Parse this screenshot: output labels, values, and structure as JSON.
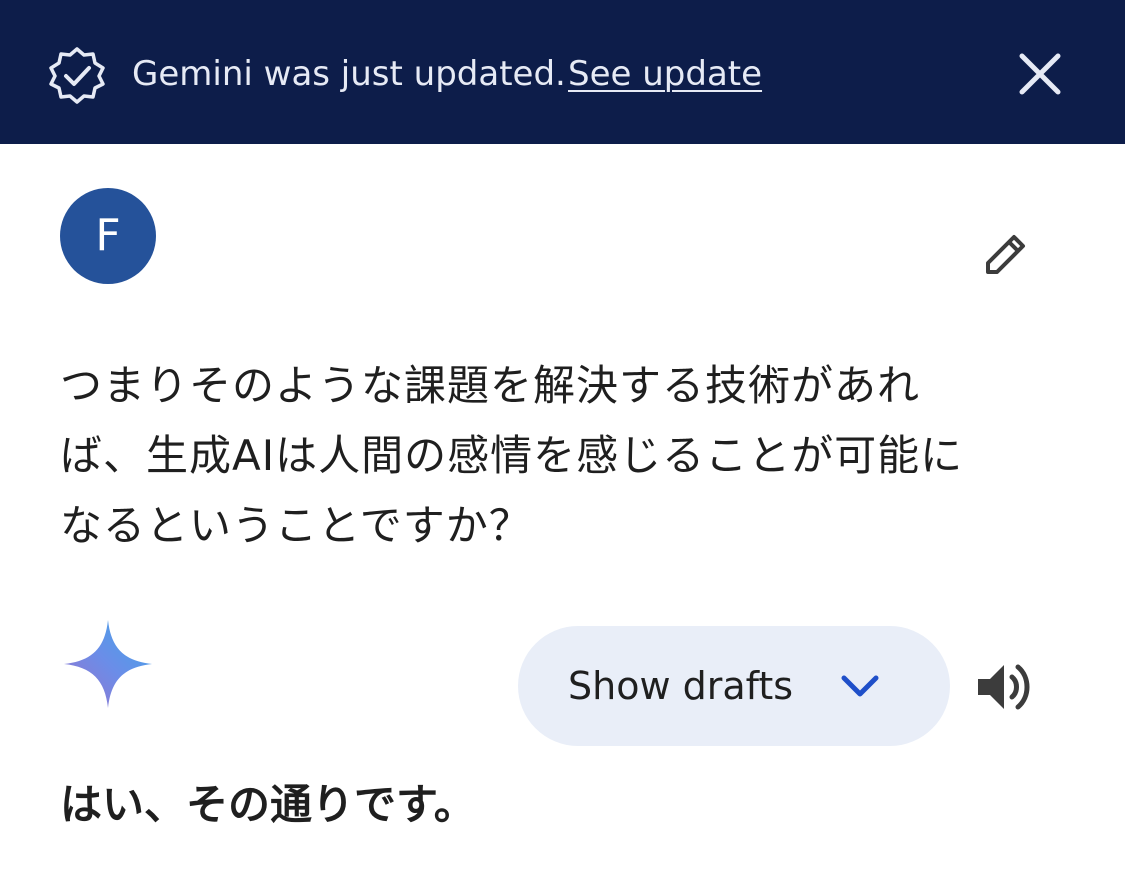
{
  "banner": {
    "message": "Gemini was just updated.",
    "link_label": "See update",
    "icon": "verified-badge-icon",
    "close_icon": "close-icon",
    "background": "#0d1d4a"
  },
  "user": {
    "avatar_initial": "F",
    "avatar_color": "#25529a",
    "edit_icon": "pencil-icon"
  },
  "prompt": {
    "lines": [
      "つまりそのような課題を解決する技術があれ",
      "ば、生成AIは人間の感情を感じることが可能に",
      "なるということですか？"
    ]
  },
  "response": {
    "icon": "gemini-sparkle-icon",
    "drafts_label": "Show drafts",
    "drafts_icon": "chevron-down-icon",
    "speaker_icon": "speaker-icon",
    "answer_text": "はい、その通りです。"
  }
}
